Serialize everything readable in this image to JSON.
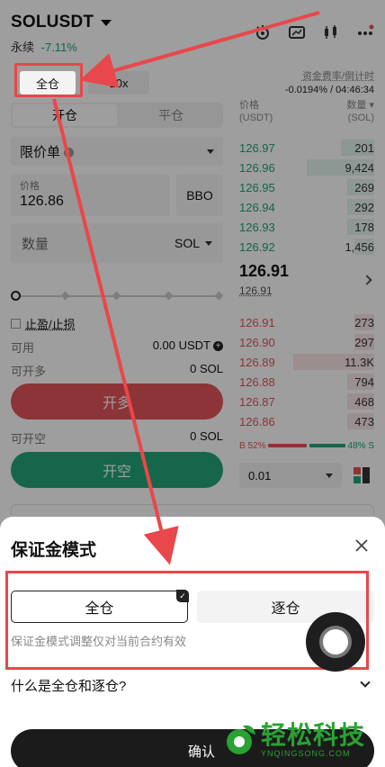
{
  "header": {
    "symbol": "SOLUSDT",
    "contract_type": "永续",
    "change": "-7.11%",
    "icons": [
      "crown-badge-icon",
      "chart-card-icon",
      "candlestick-icon",
      "more-dots-icon"
    ]
  },
  "mode": {
    "margin_mode": "全仓",
    "leverage": "10x"
  },
  "funding": {
    "label": "资金费率/倒计时",
    "value": "-0.0194% / 04:46:34"
  },
  "trade": {
    "tab_open": "开仓",
    "tab_close": "平仓",
    "order_type": "限价单",
    "price_label": "价格",
    "price_value": "126.86",
    "bbo": "BBO",
    "qty_placeholder": "数量",
    "qty_unit": "SOL",
    "tp_sl": "止盈/止损",
    "available_label": "可用",
    "available_value": "0.00 USDT",
    "open_long_label": "可开多",
    "open_long_value": "0 SOL",
    "long_button": "开多",
    "open_short_label": "可开空",
    "open_short_value": "0 SOL",
    "short_button": "开空",
    "slider_percent": 0
  },
  "orderbook": {
    "price_header": "价格",
    "price_unit": "(USDT)",
    "qty_header": "数量",
    "qty_unit": "(SOL)",
    "bids": [
      {
        "price": "126.97",
        "qty": "201",
        "depth": 0.25
      },
      {
        "price": "126.96",
        "qty": "9,424",
        "depth": 0.5
      },
      {
        "price": "126.95",
        "qty": "269",
        "depth": 0.2
      },
      {
        "price": "126.94",
        "qty": "292",
        "depth": 0.2
      },
      {
        "price": "126.93",
        "qty": "178",
        "depth": 0.2
      },
      {
        "price": "126.92",
        "qty": "1,456",
        "depth": 0.15
      }
    ],
    "last_price": "126.91",
    "mark_price": "126.91",
    "asks": [
      {
        "price": "126.91",
        "qty": "273",
        "depth": 0.15
      },
      {
        "price": "126.90",
        "qty": "297",
        "depth": 0.15
      },
      {
        "price": "126.89",
        "qty": "11.3K",
        "depth": 0.6
      },
      {
        "price": "126.88",
        "qty": "794",
        "depth": 0.2
      },
      {
        "price": "126.87",
        "qty": "468",
        "depth": 0.2
      },
      {
        "price": "126.86",
        "qty": "473",
        "depth": 0.2
      }
    ],
    "buy_ratio": "B 52%",
    "sell_ratio": "48% S",
    "step": "0.01"
  },
  "sheet": {
    "title": "保证金模式",
    "option_cross": "全仓",
    "option_isolated": "逐仓",
    "note": "保证金模式调整仅对当前合约有效",
    "faq": "什么是全仓和逐仓?",
    "confirm": "确认"
  },
  "watermark": {
    "text": "轻松科技",
    "sub": "YNQINGSONG.COM"
  },
  "colors": {
    "green": "#1aa57b",
    "red": "#e3545a",
    "highlight": "#e8474b",
    "watermark": "#2aa233"
  }
}
